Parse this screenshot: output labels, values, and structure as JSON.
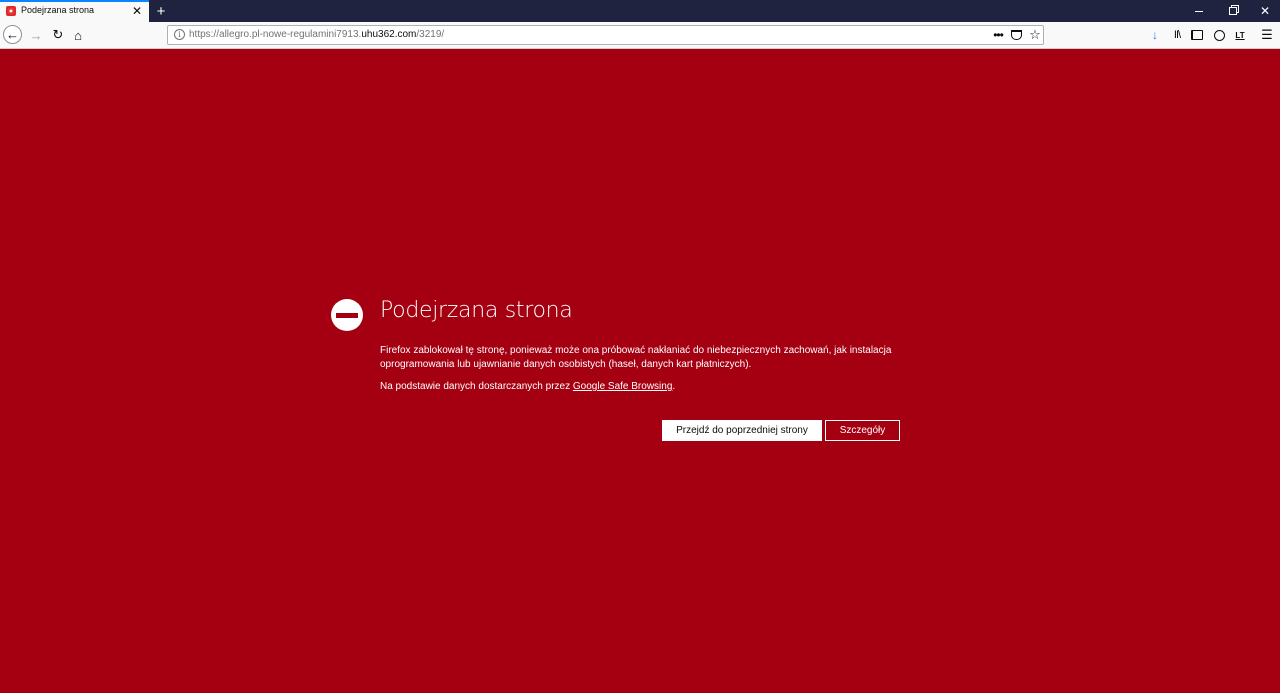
{
  "tab": {
    "title": "Podejrzana strona",
    "close_glyph": "✕"
  },
  "toolbar": {
    "new_tab_glyph": "+",
    "url_prefix": "https://allegro.pl-nowe-regulamini7913.",
    "url_domain": "uhu362.com",
    "url_suffix": "/3219/",
    "page_actions_glyph": "•••",
    "star_glyph": "☆",
    "back_glyph": "←",
    "forward_glyph": "→",
    "reload_glyph": "↻",
    "home_glyph": "⌂",
    "download_glyph": "↓",
    "library_glyph": "II\\",
    "ext_label": "LT",
    "menu_glyph": "☰"
  },
  "window_controls": {
    "close_glyph": "✕"
  },
  "error": {
    "title": "Podejrzana strona",
    "description": "Firefox zablokował tę stronę, ponieważ może ona próbować nakłaniać do niebezpiecznych zachowań, jak instalacja oprogramowania lub ujawnianie danych osobistych (haseł, danych kart płatniczych).",
    "source_prefix": "Na podstawie danych dostarczanych przez ",
    "source_link": "Google Safe Browsing",
    "source_suffix": ".",
    "back_button": "Przejdź do poprzedniej strony",
    "details_button": "Szczegóły"
  },
  "colors": {
    "page_background": "#a50011",
    "tabstrip": "#202340",
    "toolbar": "#f9f9fa",
    "accent": "#0a84ff"
  }
}
